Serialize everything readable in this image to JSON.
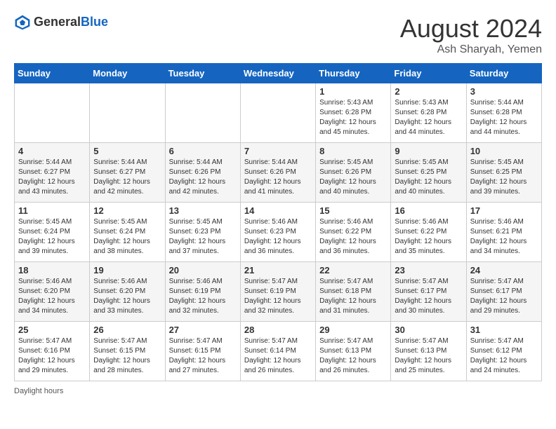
{
  "header": {
    "logo_general": "General",
    "logo_blue": "Blue",
    "month_year": "August 2024",
    "location": "Ash Sharyah, Yemen"
  },
  "days_of_week": [
    "Sunday",
    "Monday",
    "Tuesday",
    "Wednesday",
    "Thursday",
    "Friday",
    "Saturday"
  ],
  "weeks": [
    [
      {
        "day": "",
        "info": ""
      },
      {
        "day": "",
        "info": ""
      },
      {
        "day": "",
        "info": ""
      },
      {
        "day": "",
        "info": ""
      },
      {
        "day": "1",
        "info": "Sunrise: 5:43 AM\nSunset: 6:28 PM\nDaylight: 12 hours and 45 minutes."
      },
      {
        "day": "2",
        "info": "Sunrise: 5:43 AM\nSunset: 6:28 PM\nDaylight: 12 hours and 44 minutes."
      },
      {
        "day": "3",
        "info": "Sunrise: 5:44 AM\nSunset: 6:28 PM\nDaylight: 12 hours and 44 minutes."
      }
    ],
    [
      {
        "day": "4",
        "info": "Sunrise: 5:44 AM\nSunset: 6:27 PM\nDaylight: 12 hours and 43 minutes."
      },
      {
        "day": "5",
        "info": "Sunrise: 5:44 AM\nSunset: 6:27 PM\nDaylight: 12 hours and 42 minutes."
      },
      {
        "day": "6",
        "info": "Sunrise: 5:44 AM\nSunset: 6:26 PM\nDaylight: 12 hours and 42 minutes."
      },
      {
        "day": "7",
        "info": "Sunrise: 5:44 AM\nSunset: 6:26 PM\nDaylight: 12 hours and 41 minutes."
      },
      {
        "day": "8",
        "info": "Sunrise: 5:45 AM\nSunset: 6:26 PM\nDaylight: 12 hours and 40 minutes."
      },
      {
        "day": "9",
        "info": "Sunrise: 5:45 AM\nSunset: 6:25 PM\nDaylight: 12 hours and 40 minutes."
      },
      {
        "day": "10",
        "info": "Sunrise: 5:45 AM\nSunset: 6:25 PM\nDaylight: 12 hours and 39 minutes."
      }
    ],
    [
      {
        "day": "11",
        "info": "Sunrise: 5:45 AM\nSunset: 6:24 PM\nDaylight: 12 hours and 39 minutes."
      },
      {
        "day": "12",
        "info": "Sunrise: 5:45 AM\nSunset: 6:24 PM\nDaylight: 12 hours and 38 minutes."
      },
      {
        "day": "13",
        "info": "Sunrise: 5:45 AM\nSunset: 6:23 PM\nDaylight: 12 hours and 37 minutes."
      },
      {
        "day": "14",
        "info": "Sunrise: 5:46 AM\nSunset: 6:23 PM\nDaylight: 12 hours and 36 minutes."
      },
      {
        "day": "15",
        "info": "Sunrise: 5:46 AM\nSunset: 6:22 PM\nDaylight: 12 hours and 36 minutes."
      },
      {
        "day": "16",
        "info": "Sunrise: 5:46 AM\nSunset: 6:22 PM\nDaylight: 12 hours and 35 minutes."
      },
      {
        "day": "17",
        "info": "Sunrise: 5:46 AM\nSunset: 6:21 PM\nDaylight: 12 hours and 34 minutes."
      }
    ],
    [
      {
        "day": "18",
        "info": "Sunrise: 5:46 AM\nSunset: 6:20 PM\nDaylight: 12 hours and 34 minutes."
      },
      {
        "day": "19",
        "info": "Sunrise: 5:46 AM\nSunset: 6:20 PM\nDaylight: 12 hours and 33 minutes."
      },
      {
        "day": "20",
        "info": "Sunrise: 5:46 AM\nSunset: 6:19 PM\nDaylight: 12 hours and 32 minutes."
      },
      {
        "day": "21",
        "info": "Sunrise: 5:47 AM\nSunset: 6:19 PM\nDaylight: 12 hours and 32 minutes."
      },
      {
        "day": "22",
        "info": "Sunrise: 5:47 AM\nSunset: 6:18 PM\nDaylight: 12 hours and 31 minutes."
      },
      {
        "day": "23",
        "info": "Sunrise: 5:47 AM\nSunset: 6:17 PM\nDaylight: 12 hours and 30 minutes."
      },
      {
        "day": "24",
        "info": "Sunrise: 5:47 AM\nSunset: 6:17 PM\nDaylight: 12 hours and 29 minutes."
      }
    ],
    [
      {
        "day": "25",
        "info": "Sunrise: 5:47 AM\nSunset: 6:16 PM\nDaylight: 12 hours and 29 minutes."
      },
      {
        "day": "26",
        "info": "Sunrise: 5:47 AM\nSunset: 6:15 PM\nDaylight: 12 hours and 28 minutes."
      },
      {
        "day": "27",
        "info": "Sunrise: 5:47 AM\nSunset: 6:15 PM\nDaylight: 12 hours and 27 minutes."
      },
      {
        "day": "28",
        "info": "Sunrise: 5:47 AM\nSunset: 6:14 PM\nDaylight: 12 hours and 26 minutes."
      },
      {
        "day": "29",
        "info": "Sunrise: 5:47 AM\nSunset: 6:13 PM\nDaylight: 12 hours and 26 minutes."
      },
      {
        "day": "30",
        "info": "Sunrise: 5:47 AM\nSunset: 6:13 PM\nDaylight: 12 hours and 25 minutes."
      },
      {
        "day": "31",
        "info": "Sunrise: 5:47 AM\nSunset: 6:12 PM\nDaylight: 12 hours and 24 minutes."
      }
    ]
  ],
  "footer": {
    "daylight_label": "Daylight hours"
  },
  "colors": {
    "header_bg": "#1565c0",
    "logo_blue": "#1565c0"
  }
}
